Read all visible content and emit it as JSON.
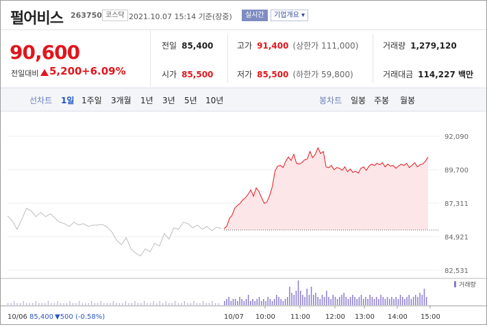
{
  "stock": {
    "name": "펄어비스",
    "code": "263750",
    "market": "코스닥",
    "datetime": "2021.10.07 15:14 기준(장중)",
    "realtime_label": "실시간",
    "company_info_label": "기업개요 ▾"
  },
  "price": {
    "current": "90,600",
    "change_label": "전일대비",
    "change_amount": "5,200",
    "change_pct": "+6.09%",
    "direction": "up",
    "up_color": "#e0161c"
  },
  "stats": {
    "prev_close": {
      "label": "전일",
      "value": "85,400"
    },
    "high": {
      "label": "고가",
      "value": "91,400",
      "sub_label": "(상한가",
      "sub_value": "111,000)"
    },
    "volume": {
      "label": "거래량",
      "value": "1,279,120"
    },
    "open": {
      "label": "시가",
      "value": "85,500"
    },
    "low": {
      "label": "저가",
      "value": "85,500",
      "sub_label": "(하한가",
      "sub_value": "59,800)"
    },
    "trade_value": {
      "label": "거래대금",
      "value": "114,227 백만"
    }
  },
  "tabs": {
    "line_label": "선차트",
    "periods": [
      "1일",
      "1주일",
      "3개월",
      "1년",
      "3년",
      "5년",
      "10년"
    ],
    "active_period": "1일",
    "candle_label": "봉차트",
    "candle_periods": [
      "일봉",
      "주봉",
      "월봉"
    ]
  },
  "chart_data": {
    "type": "line",
    "y_ticks": [
      "92,090",
      "89,700",
      "87,311",
      "84,921",
      "82,531"
    ],
    "ylim": [
      82531,
      92090
    ],
    "prev_close": 85400,
    "x_labels": [
      "10:00",
      "11:00",
      "12:00",
      "13:00",
      "14:00",
      "15:00"
    ],
    "prev_day_x_label": "10/07",
    "volume_legend": "거래량",
    "footer_prev": "10/06",
    "footer_prev_close": "85,400",
    "footer_change": "▼500",
    "footer_pct": "(-0.58%)",
    "series": [
      {
        "values_prev_day": [
          86400,
          86050,
          85450,
          86150,
          86950,
          86750,
          86350,
          86650,
          86350,
          86550,
          86250,
          85950,
          85850,
          85650,
          85950,
          85750,
          85850,
          85650,
          85750,
          85750,
          85800,
          85600,
          85250,
          84650,
          84350,
          84850,
          84050,
          83750,
          83550,
          84050,
          83850,
          84450,
          84250,
          85150,
          84750,
          85550,
          85450,
          85950,
          85850,
          85550,
          85750,
          85450,
          85650,
          85350,
          85600,
          85500
        ],
        "values_today": [
          85500,
          85650,
          86200,
          86450,
          86950,
          87150,
          87300,
          87550,
          87700,
          87950,
          88250,
          87800,
          88400,
          88150,
          87700,
          87300,
          87400,
          87850,
          88500,
          89600,
          89950,
          90000,
          89850,
          90300,
          90600,
          90350,
          90800,
          90150,
          90100,
          90200,
          90400,
          90450,
          91000,
          90550,
          90800,
          91250,
          90850,
          91000,
          89900,
          89850,
          90000,
          89700,
          89850,
          89800,
          89650,
          89900,
          89550,
          89750,
          89500,
          89600,
          89450,
          89800,
          89900,
          89650,
          89950,
          90100,
          90000,
          90150,
          90050,
          90200,
          89900,
          90100,
          89950,
          90000,
          89800,
          89950,
          90100,
          90000,
          90150,
          89850,
          90000,
          90200,
          89900,
          90050,
          90100,
          90300,
          90600
        ]
      }
    ],
    "volume_prev_day": [
      1,
      1,
      2,
      1,
      1,
      2,
      1,
      1,
      1,
      2,
      1,
      1,
      1,
      2,
      1,
      1,
      2,
      1,
      1,
      1,
      2,
      1,
      1,
      2,
      1,
      1,
      1,
      2,
      1,
      1,
      2,
      1,
      1,
      1,
      2,
      1,
      1,
      1,
      2,
      1,
      1,
      2,
      1,
      1,
      2,
      1,
      1,
      2,
      1,
      2,
      1,
      2,
      1,
      1,
      2,
      1,
      1,
      2,
      1,
      1,
      2,
      1,
      1,
      2,
      1,
      1,
      2,
      1,
      1
    ],
    "volume_today": [
      2,
      3,
      4,
      2,
      3,
      3,
      2,
      4,
      3,
      2,
      3,
      5,
      2,
      3,
      2,
      3,
      4,
      2,
      3,
      2,
      4,
      3,
      2,
      3,
      5,
      4,
      3,
      2,
      3,
      4,
      9,
      6,
      5,
      7,
      12,
      7,
      5,
      4,
      8,
      5,
      9,
      5,
      6,
      4,
      3,
      5,
      4,
      7,
      4,
      3,
      5,
      4,
      3,
      4,
      5,
      6,
      4,
      3,
      4,
      5,
      4,
      3,
      4,
      5,
      3,
      4,
      3,
      5,
      4,
      3,
      4,
      3,
      5,
      4,
      3,
      4,
      3,
      4,
      3,
      4,
      3,
      5,
      4,
      3,
      4,
      5,
      3,
      4,
      5,
      4,
      6,
      5,
      8,
      4
    ]
  }
}
